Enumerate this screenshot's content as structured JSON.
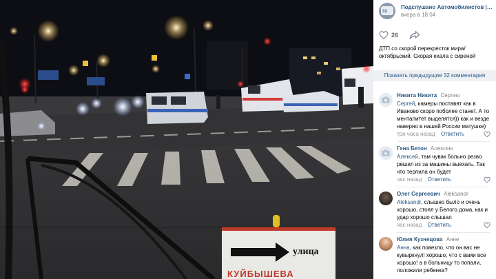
{
  "post": {
    "group_name": "Подслушано Автомобилистов | Вл...",
    "group_avatar_text": "33",
    "time": "вчера в 18:04",
    "likes": "26",
    "text": "ДТП со скорой перекресток мира/ октябрьский. Скорая ехала с сиреной"
  },
  "photo": {
    "sign_text": "улица",
    "sign_bottom_text": "КУЙБЫШЕВА"
  },
  "comments_header": "Показать предыдущие 32 комментария",
  "comments": [
    {
      "author": "Никита Никита",
      "reply_to": "Сергею",
      "mention": "Сергей",
      "text": ", камеры поставят как в Иваново скоро поболее станет. А то менталитет выделятся)) как и везде наверно в нашей России матушке)",
      "time": "три часа назад",
      "reply_label": "Ответить",
      "avatar": "camera-placeholder"
    },
    {
      "author": "Гена Бетон",
      "reply_to": "Алексею",
      "mention": "Алексей",
      "text": ", там чувак больно резво решил из за машины выехать. Так что терпила он будет",
      "time": "час назад",
      "reply_label": "Ответить",
      "avatar": "camera-placeholder"
    },
    {
      "author": "Олег Сергеевич",
      "reply_to": "Aleksandr",
      "mention": "Aleksandr",
      "text": ", слышно было и очень хорошо, стоял у Белого дома, как и удар хорошо слышал",
      "time": "час назад",
      "reply_label": "Ответить",
      "avatar": "photo"
    },
    {
      "author": "Юлия Кузнецова",
      "reply_to": "Анне",
      "mention": "Анна",
      "text": ", как повезло, что он вас не кувыркнул! хорошо, что с вами все хорошо! а в больницу то попали, положили ребенка?",
      "time": "",
      "reply_label": "",
      "avatar": "photo"
    }
  ],
  "colors": {
    "link": "#2a5885",
    "muted": "#828282",
    "comments_bar": "#eef0f3"
  }
}
